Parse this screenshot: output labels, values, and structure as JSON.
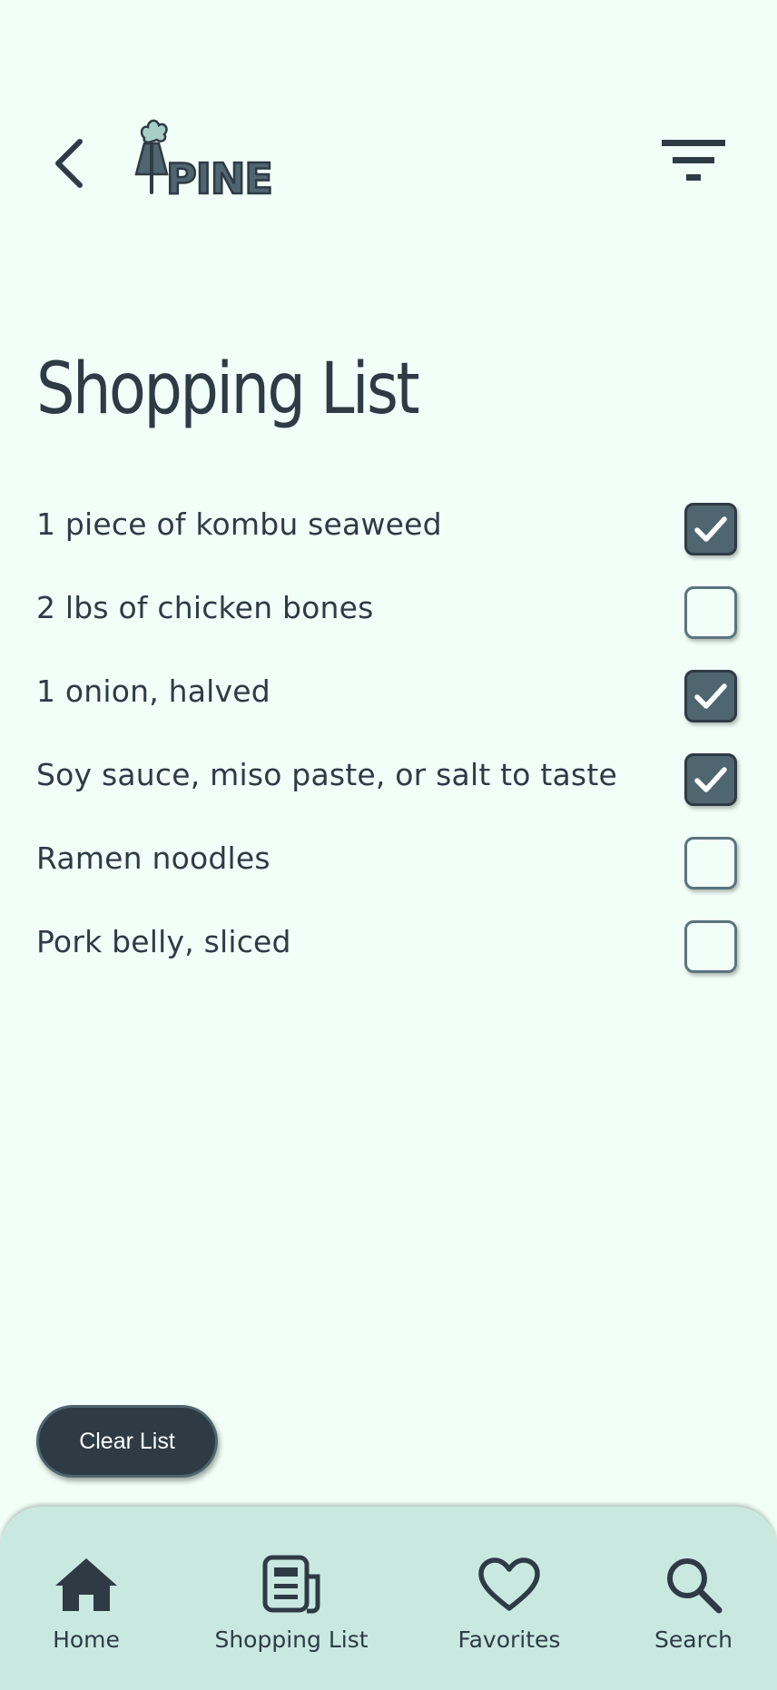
{
  "header": {
    "back_icon": "chevron-left-icon",
    "logo_text": "PINE",
    "filter_icon": "filter-icon"
  },
  "page": {
    "title": "Shopping List"
  },
  "items": [
    {
      "label": "1 piece of kombu seaweed",
      "checked": true
    },
    {
      "label": "2 lbs of chicken bones",
      "checked": false
    },
    {
      "label": "1 onion, halved",
      "checked": true
    },
    {
      "label": "Soy sauce, miso paste, or salt to taste",
      "checked": true
    },
    {
      "label": "Ramen noodles",
      "checked": false
    },
    {
      "label": "Pork belly, sliced",
      "checked": false
    }
  ],
  "actions": {
    "clear_label": "Clear List"
  },
  "nav": {
    "items": [
      {
        "label": "Home",
        "icon": "home-icon"
      },
      {
        "label": "Shopping List",
        "icon": "list-icon"
      },
      {
        "label": "Favorites",
        "icon": "heart-icon"
      },
      {
        "label": "Search",
        "icon": "search-icon"
      }
    ]
  },
  "colors": {
    "background": "#f2fff8",
    "primary_dark": "#2e3b45",
    "accent": "#4f6670",
    "nav_background": "#c9e9e0"
  }
}
